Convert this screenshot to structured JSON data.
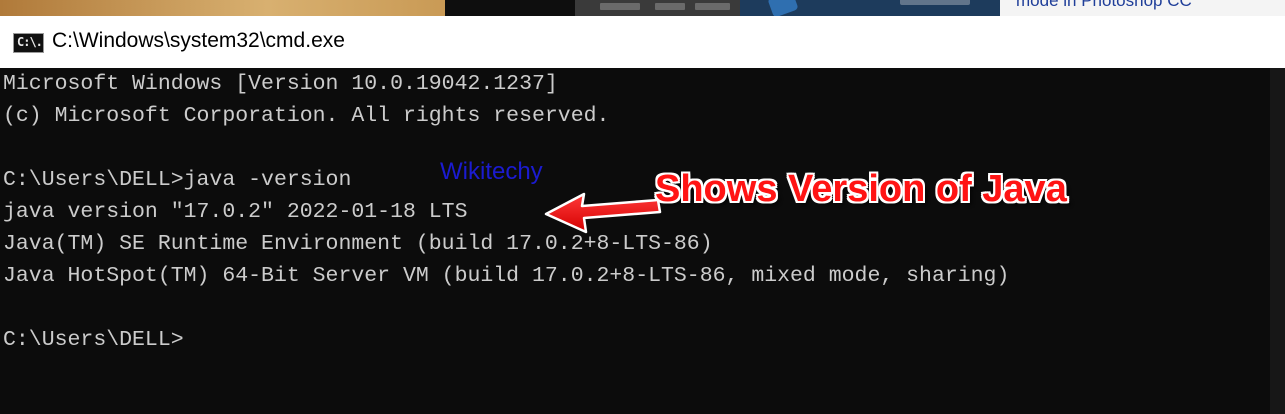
{
  "window": {
    "title": "C:\\Windows\\system32\\cmd.exe",
    "icon": "cmd-icon",
    "icon_text": "C:\\."
  },
  "background": {
    "snippet_text": "mode in Photoshop CC"
  },
  "console": {
    "lines": [
      "Microsoft Windows [Version 10.0.19042.1237]",
      "(c) Microsoft Corporation. All rights reserved.",
      "",
      "C:\\Users\\DELL>java -version",
      "java version \"17.0.2\" 2022-01-18 LTS",
      "Java(TM) SE Runtime Environment (build 17.0.2+8-LTS-86)",
      "Java HotSpot(TM) 64-Bit Server VM (build 17.0.2+8-LTS-86, mixed mode, sharing)",
      "",
      "C:\\Users\\DELL>"
    ]
  },
  "annotations": {
    "watermark": "Wikitechy",
    "callout": "Shows Version of Java",
    "callout_color": "#ff1414",
    "watermark_color": "#1b1bd0"
  },
  "colors": {
    "console_bg": "#0c0c0c",
    "console_text": "#cccccc"
  }
}
